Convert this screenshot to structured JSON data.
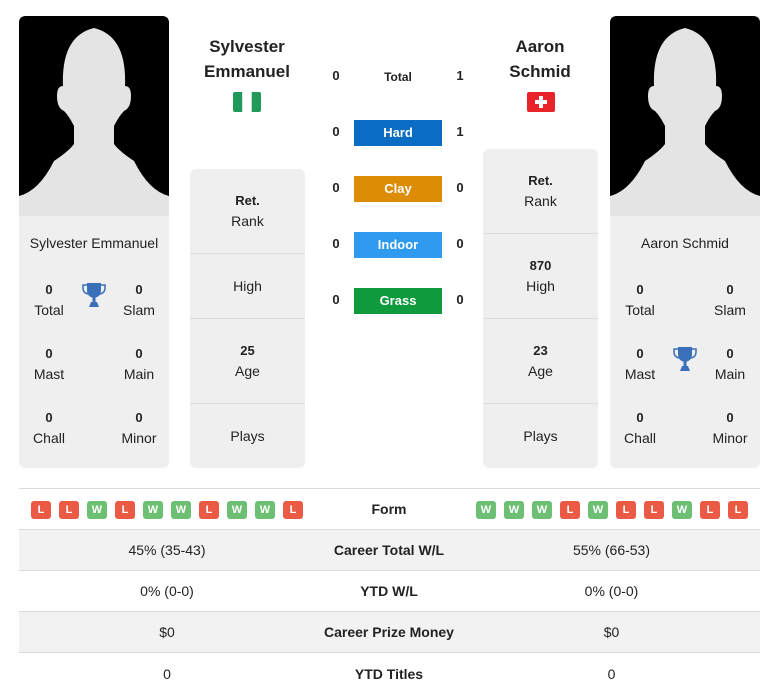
{
  "players": {
    "left": {
      "name": "Sylvester Emmanuel",
      "name_line1": "Sylvester",
      "name_line2": "Emmanuel",
      "flag": "nigeria-flag",
      "titles": {
        "total": {
          "value": "0",
          "label": "Total"
        },
        "slam": {
          "value": "0",
          "label": "Slam"
        },
        "mast": {
          "value": "0",
          "label": "Mast"
        },
        "main": {
          "value": "0",
          "label": "Main"
        },
        "chall": {
          "value": "0",
          "label": "Chall"
        },
        "minor": {
          "value": "0",
          "label": "Minor"
        }
      },
      "info": {
        "rank": {
          "value": "Ret.",
          "label": "Rank"
        },
        "high": {
          "value": "",
          "label": "High"
        },
        "age": {
          "value": "25",
          "label": "Age"
        },
        "plays": {
          "value": "",
          "label": "Plays"
        }
      },
      "form": [
        "L",
        "L",
        "W",
        "L",
        "W",
        "W",
        "L",
        "W",
        "W",
        "L"
      ]
    },
    "right": {
      "name": "Aaron Schmid",
      "name_line1": "Aaron",
      "name_line2": "Schmid",
      "flag": "switzerland-flag",
      "titles": {
        "total": {
          "value": "0",
          "label": "Total"
        },
        "slam": {
          "value": "0",
          "label": "Slam"
        },
        "mast": {
          "value": "0",
          "label": "Mast"
        },
        "main": {
          "value": "0",
          "label": "Main"
        },
        "chall": {
          "value": "0",
          "label": "Chall"
        },
        "minor": {
          "value": "0",
          "label": "Minor"
        }
      },
      "info": {
        "rank": {
          "value": "Ret.",
          "label": "Rank"
        },
        "high": {
          "value": "870",
          "label": "High"
        },
        "age": {
          "value": "23",
          "label": "Age"
        },
        "plays": {
          "value": "",
          "label": "Plays"
        }
      },
      "form": [
        "W",
        "W",
        "W",
        "L",
        "W",
        "L",
        "L",
        "W",
        "L",
        "L"
      ]
    }
  },
  "h2h": [
    {
      "label": "Total",
      "left": "0",
      "right": "1",
      "color": null
    },
    {
      "label": "Hard",
      "left": "0",
      "right": "1",
      "color": "#0a6cc2"
    },
    {
      "label": "Clay",
      "left": "0",
      "right": "0",
      "color": "#dc8c05"
    },
    {
      "label": "Indoor",
      "left": "0",
      "right": "0",
      "color": "#2f9bf0"
    },
    {
      "label": "Grass",
      "left": "0",
      "right": "0",
      "color": "#0f9a3e"
    }
  ],
  "form_label": "Form",
  "stats": [
    {
      "label": "Career Total W/L",
      "left": "45% (35-43)",
      "right": "55% (66-53)"
    },
    {
      "label": "YTD W/L",
      "left": "0% (0-0)",
      "right": "0% (0-0)"
    },
    {
      "label": "Career Prize Money",
      "left": "$0",
      "right": "$0"
    },
    {
      "label": "YTD Titles",
      "left": "0",
      "right": "0"
    }
  ]
}
